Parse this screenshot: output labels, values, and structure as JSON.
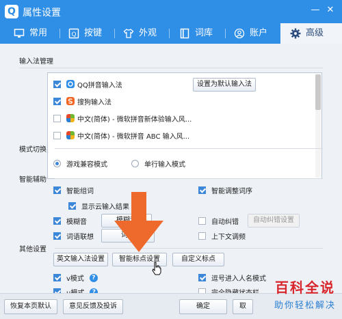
{
  "window": {
    "title": "属性设置",
    "logo_letter": "Q",
    "minimize": "—",
    "close": "✕"
  },
  "tabs": [
    {
      "label": "常用",
      "icon": "monitor-icon"
    },
    {
      "label": "按键",
      "icon": "key-icon"
    },
    {
      "label": "外观",
      "icon": "shirt-icon"
    },
    {
      "label": "词库",
      "icon": "book-icon"
    },
    {
      "label": "账户",
      "icon": "user-icon"
    },
    {
      "label": "高级",
      "icon": "gear-icon",
      "active": true
    }
  ],
  "ime_section": {
    "title": "输入法管理",
    "items": [
      {
        "label": "QQ拼音输入法",
        "checked": true,
        "icon": "qq-pinyin-icon"
      },
      {
        "label": "搜狗输入法",
        "checked": true,
        "icon": "sogou-icon"
      },
      {
        "label": "中文(简体) - 微软拼音新体验输入风...",
        "checked": false,
        "icon": "ms-pinyin-icon"
      },
      {
        "label": "中文(简体) - 微软拼音 ABC 输入风...",
        "checked": false,
        "icon": "ms-abc-icon"
      }
    ],
    "set_default_button": "设置为默认输入法"
  },
  "mode_section": {
    "title": "模式切换",
    "game_mode": "游戏兼容模式",
    "single_line_mode": "单行输入模式"
  },
  "assist_section": {
    "title": "智能辅助",
    "smart_group": "智能组词",
    "smart_adjust": "智能调整词序",
    "cloud_result": "显示云输入结果",
    "fuzzy": "模糊音",
    "fuzzy_btn": "模糊音",
    "auto_correct": "自动纠错",
    "auto_correct_btn": "自动纠错设置",
    "assoc": "词语联想",
    "assoc_btn": "词语",
    "context": "上下文调频"
  },
  "other_section": {
    "title": "其他设置",
    "english_btn": "英文输入法设置",
    "punct_btn": "智能标点设置",
    "custom_btn": "自定义标点",
    "v_mode": "v模式",
    "u_mode": "u模式",
    "name_mode": "逗号进入人名模式",
    "hide_status": "完全隐藏状态栏"
  },
  "footer": {
    "restore": "恢复本页默认",
    "feedback": "意见反馈及投诉",
    "ok": "确定",
    "cancel": "取"
  },
  "watermark": {
    "main": "百科全说",
    "sub": "助你轻松解决"
  }
}
